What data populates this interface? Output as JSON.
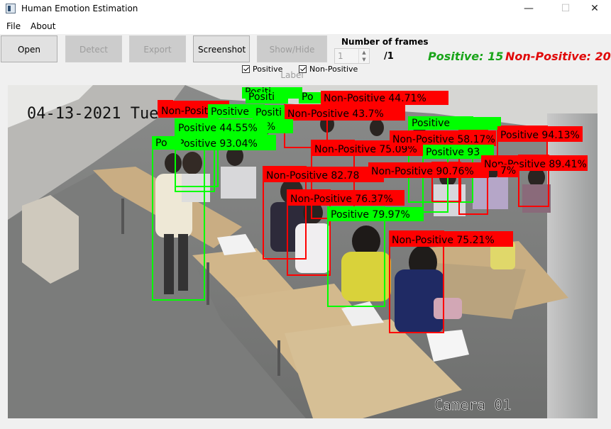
{
  "window": {
    "title": "Human Emotion Estimation",
    "minimize": "—",
    "maximize": "☐",
    "close": "✕"
  },
  "menu": [
    "File",
    "About"
  ],
  "toolbar": {
    "open": "Open",
    "detect": "Detect",
    "export": "Export",
    "screenshot": "Screenshot",
    "show_hide": "Show/Hide Label",
    "frames_label": "Number of frames",
    "frame_value": "1",
    "frame_total": "/1",
    "positive_count": "Positive: 15",
    "nonpositive_count": "Non-Positive: 20",
    "check_positive": "Positive",
    "check_nonpositive": "Non-Positive"
  },
  "video": {
    "timestamp": "04-13-2021 Tue",
    "camera": "Camera 01"
  },
  "colors": {
    "positive": "#00ff00",
    "nonpositive": "#ff0000",
    "positive_text": "#1aa51a",
    "nonpositive_text": "#e00a0a"
  },
  "detections": [
    {
      "label": "Positi",
      "type": "positive"
    },
    {
      "label": "Positi",
      "type": "positive"
    },
    {
      "label": "Po",
      "type": "positive"
    },
    {
      "label": "Non-Positive 44.71%",
      "type": "nonpositive"
    },
    {
      "label": "Non-Positive",
      "type": "nonpositive"
    },
    {
      "label": "Positive",
      "type": "positive"
    },
    {
      "label": "Positi",
      "type": "positive"
    },
    {
      "label": "Non-Positive 43.7%",
      "type": "nonpositive"
    },
    {
      "label": "24%",
      "type": "positive"
    },
    {
      "label": "Positive 44.55%",
      "type": "positive"
    },
    {
      "label": "Positive 93.04%",
      "type": "positive"
    },
    {
      "label": "Po",
      "type": "positive"
    },
    {
      "label": "Positive",
      "type": "positive"
    },
    {
      "label": "Non-Positive 82.78",
      "type": "nonpositive"
    },
    {
      "label": "Non-Positive 75.09%",
      "type": "nonpositive"
    },
    {
      "label": "Non-Positive 90.76%",
      "type": "nonpositive"
    },
    {
      "label": "Non-Positive 76.37%",
      "type": "nonpositive"
    },
    {
      "label": "Positive 79.97%",
      "type": "positive"
    },
    {
      "label": "Non-Positive 58.17%",
      "type": "nonpositive"
    },
    {
      "label": "Positive 93",
      "type": "positive"
    },
    {
      "label": "Non-Positive 89.41%",
      "type": "nonpositive"
    },
    {
      "label": "Non-Positive 75.21%",
      "type": "nonpositive"
    },
    {
      "label": "Positive 94.13%",
      "type": "nonpositive"
    },
    {
      "label": "7%",
      "type": "nonpositive"
    }
  ]
}
